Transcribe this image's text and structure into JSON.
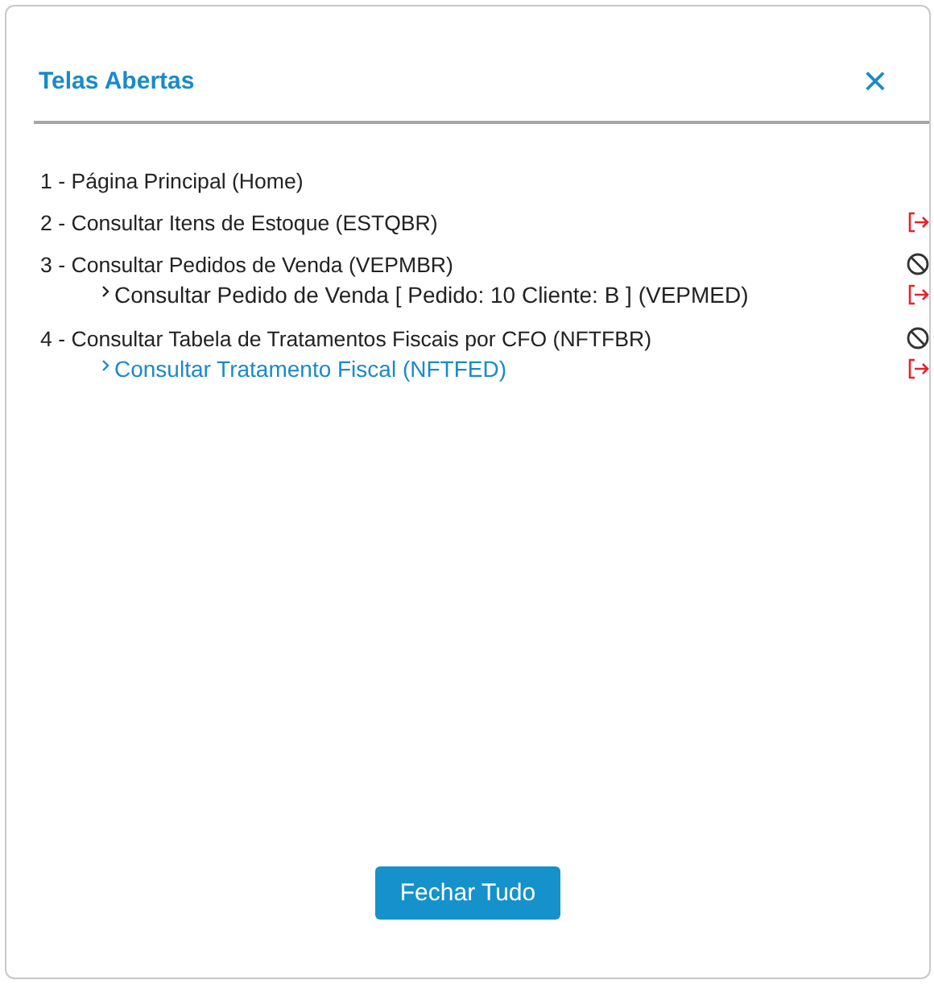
{
  "dialog": {
    "title": "Telas Abertas",
    "close": "×"
  },
  "screens": [
    {
      "label": "1 - Página Principal (Home)"
    },
    {
      "label": "2 - Consultar Itens de Estoque (ESTQBR)",
      "kind": "close"
    },
    {
      "label": "3 - Consultar Pedidos de Venda (VEPMBR)",
      "kind": "block",
      "children": [
        {
          "label": "Consultar Pedido de Venda [ Pedido: 10 Cliente: B ] (VEPMED)",
          "selected": false,
          "kind": "close"
        }
      ]
    },
    {
      "label": "4 - Consultar Tabela de Tratamentos Fiscais por CFO (NFTFBR)",
      "kind": "block",
      "children": [
        {
          "label": "Consultar Tratamento Fiscal (NFTFED)",
          "selected": true,
          "kind": "close"
        }
      ]
    }
  ],
  "footer": {
    "button": "Fechar Tudo"
  }
}
